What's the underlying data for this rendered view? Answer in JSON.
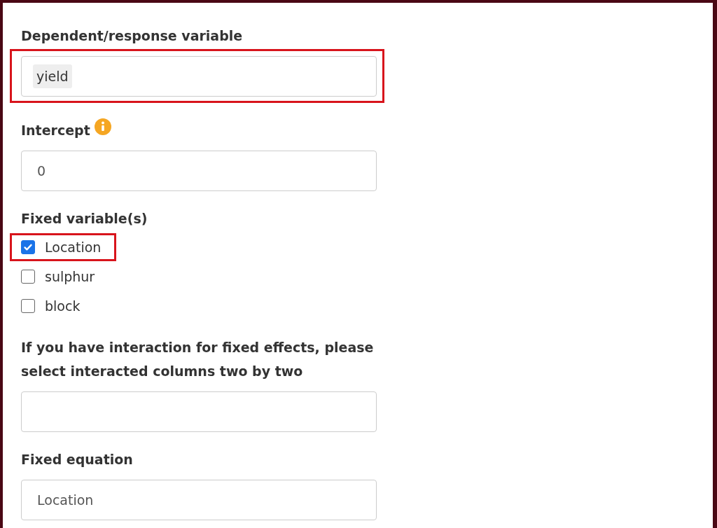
{
  "fields": [
    {
      "kind": "tags",
      "label": "Dependent/response variable",
      "tags": [
        "yield"
      ],
      "highlighted": true
    },
    {
      "kind": "input",
      "label": "Intercept",
      "info": true,
      "value": "0"
    },
    {
      "kind": "checkboxes",
      "label": "Fixed variable(s)",
      "options": [
        {
          "label": "Location",
          "checked": true,
          "highlighted": true
        },
        {
          "label": "sulphur",
          "checked": false,
          "highlighted": false
        },
        {
          "label": "block",
          "checked": false,
          "highlighted": false
        }
      ]
    },
    {
      "kind": "input",
      "label": "If you have interaction for fixed effects, please select interacted columns two by two"
    },
    {
      "kind": "input",
      "label": "Fixed equation",
      "value": "Location"
    }
  ]
}
